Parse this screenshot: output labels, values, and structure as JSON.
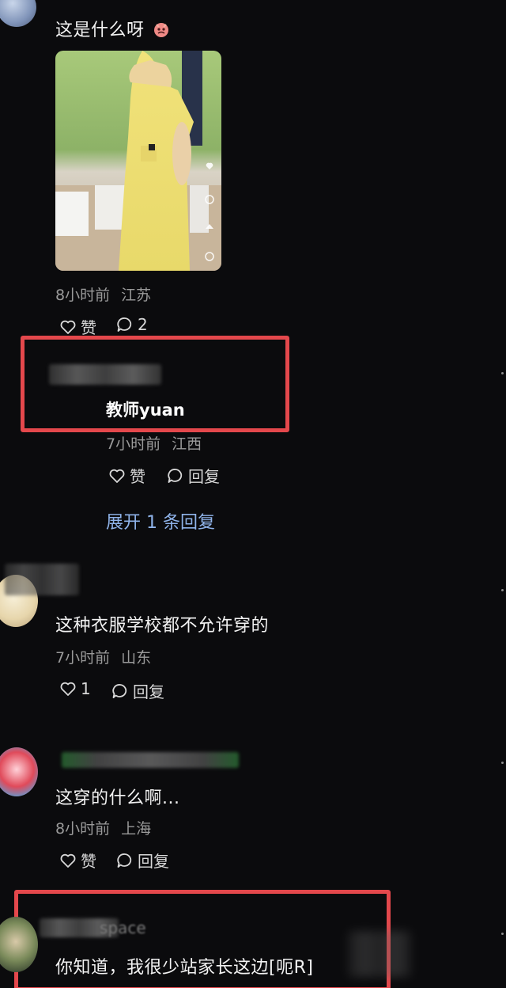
{
  "comments": [
    {
      "text": "这是什么呀",
      "time": "8小时前",
      "location": "江苏",
      "like_label": "赞",
      "reply_count": "2"
    },
    {
      "username": "教师yuan",
      "time": "7小时前",
      "location": "江西",
      "like_label": "赞",
      "reply_label": "回复",
      "expand_label": "展开 1 条回复"
    },
    {
      "text": "这种衣服学校都不允许穿的",
      "time": "7小时前",
      "location": "山东",
      "like_count": "1",
      "reply_label": "回复"
    },
    {
      "text": "这穿的什么啊...",
      "time": "8小时前",
      "location": "上海",
      "like_label": "赞",
      "reply_label": "回复"
    },
    {
      "name_fragment": "space",
      "text": "你知道，我很少站家长这边[呃R]"
    }
  ],
  "colors": {
    "background": "#0b0b0d",
    "highlight_box": "#e4484c",
    "expand_link": "#8fb3e9",
    "meta_text": "#9a9a9a"
  }
}
